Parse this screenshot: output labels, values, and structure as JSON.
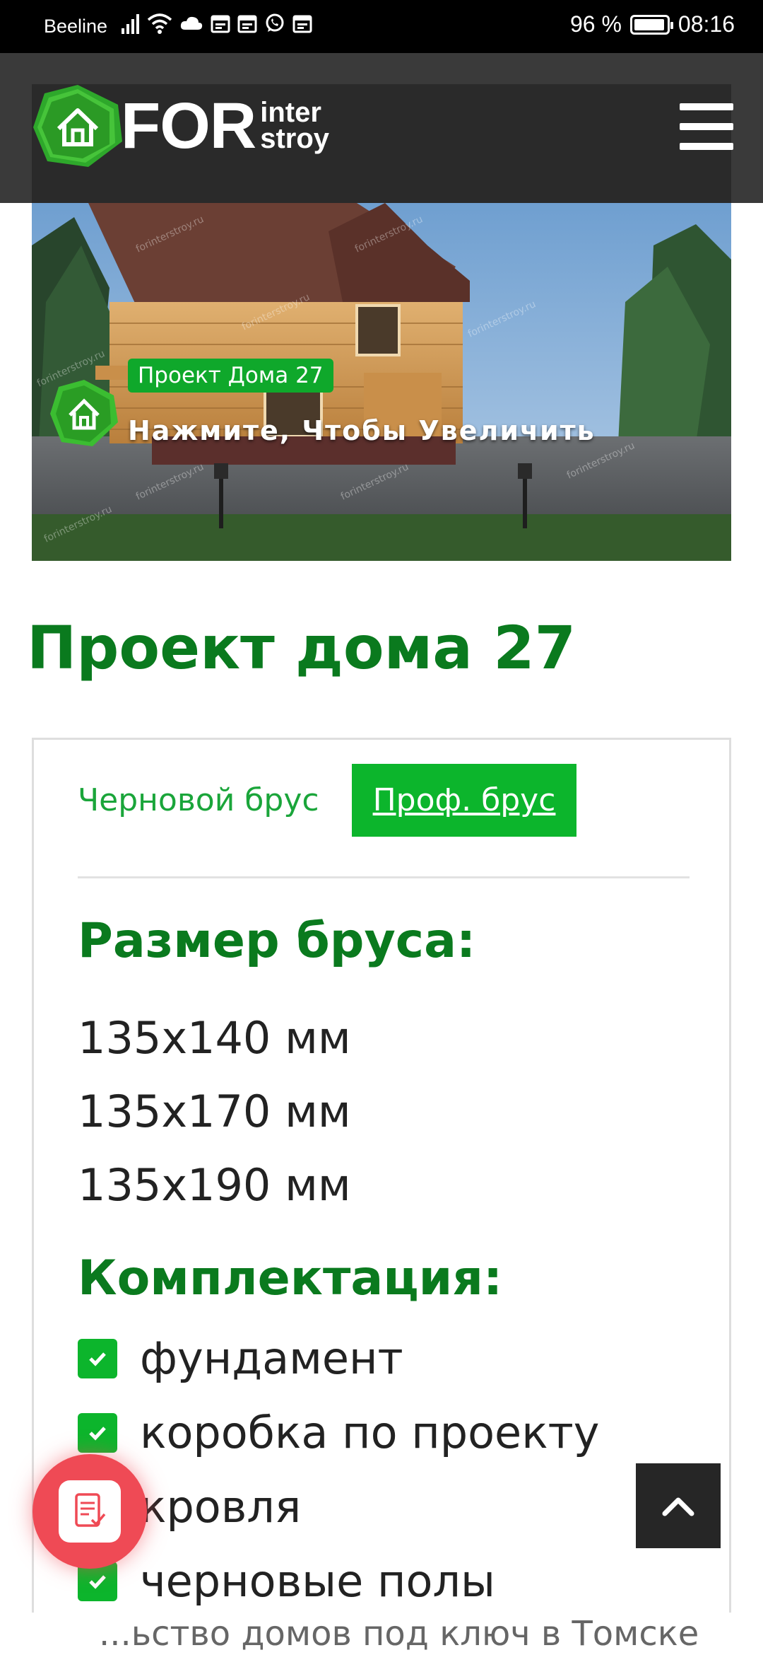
{
  "status_bar": {
    "carrier": "Beeline",
    "battery": "96 %",
    "battery_level": 0.96,
    "time": "08:16",
    "icons": [
      "signal-icon",
      "wifi-icon",
      "cloud-icon",
      "calendar-icon",
      "calendar-icon",
      "whatsapp-icon",
      "calendar-icon"
    ]
  },
  "header": {
    "logo_main": "FOR",
    "logo_sub_top": "inter",
    "logo_sub_bottom": "stroy",
    "menu_icon": "hamburger-menu-icon"
  },
  "hero": {
    "tag": "Проект Дома 27",
    "caption": "Нажмите, Чтобы Увеличить",
    "watermark": "forinterstroy.ru"
  },
  "page": {
    "title": "Проект дома 27"
  },
  "tabs": {
    "items": [
      {
        "label": "Черновой брус",
        "active": false
      },
      {
        "label": "Проф. брус",
        "active": true
      }
    ]
  },
  "timber": {
    "heading": "Размер бруса:",
    "sizes": [
      "135x140 мм",
      "135x170 мм",
      "135x190 мм"
    ]
  },
  "kit": {
    "heading": "Комплектация:",
    "items": [
      "фундамент",
      "коробка по проекту",
      "кровля",
      "черновые полы"
    ]
  },
  "footer_strip": {
    "text": "...ьство домов под ключ в Томске"
  },
  "colors": {
    "brand_green": "#0cb52c",
    "heading_green": "#0a7a1e",
    "fab_red": "#ef4a55",
    "header_dark": "#2a2a2a"
  }
}
